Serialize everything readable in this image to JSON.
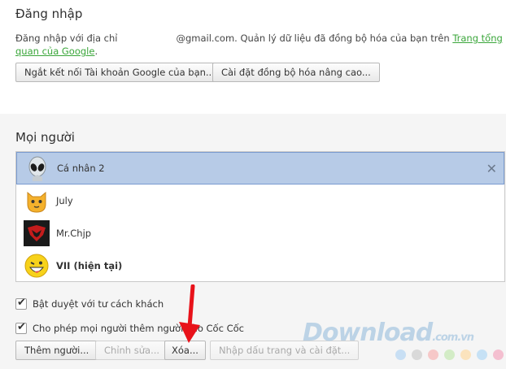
{
  "signin": {
    "title": "Đăng nhập",
    "text_before": "Đăng nhập với địa chỉ",
    "text_after": "@gmail.com. Quản lý dữ liệu đã đồng bộ hóa của bạn trên",
    "link_text": "Trang tổng quan của Google",
    "text_end": ".",
    "disconnect_label": "Ngắt kết nối Tài khoản Google của bạn...",
    "advanced_sync_label": "Cài đặt đồng bộ hóa nâng cao..."
  },
  "people": {
    "title": "Mọi người",
    "users": [
      {
        "name": "Cá nhân 2",
        "avatar": "alien-avatar",
        "selected": true
      },
      {
        "name": "July",
        "avatar": "cat-avatar",
        "selected": false
      },
      {
        "name": "Mr.Chjp",
        "avatar": "red-logo-avatar",
        "selected": false
      },
      {
        "name": "VII (hiện tại)",
        "avatar": "smiley-avatar",
        "selected": false,
        "current": true
      }
    ],
    "remove_glyph": "✕",
    "guest_label": "Bật duyệt với tư cách khách",
    "allow_add_label": "Cho phép mọi người thêm người vào Cốc Cốc",
    "add_label": "Thêm người...",
    "edit_label": "Chỉnh sửa...",
    "delete_label": "Xóa...",
    "import_label": "Nhập dấu trang và cài đặt..."
  },
  "watermark": {
    "text": "Download",
    "suffix": ".com.vn"
  },
  "colors": {
    "link": "#3aa63a",
    "selected_row": "#b7cbe7",
    "arrow": "#e8121a",
    "dots": [
      "#c8dff4",
      "#d9d9d9",
      "#f6c8c8",
      "#d3ecc6",
      "#fbe3bd",
      "#c6e1f5",
      "#f4bfd0"
    ]
  }
}
